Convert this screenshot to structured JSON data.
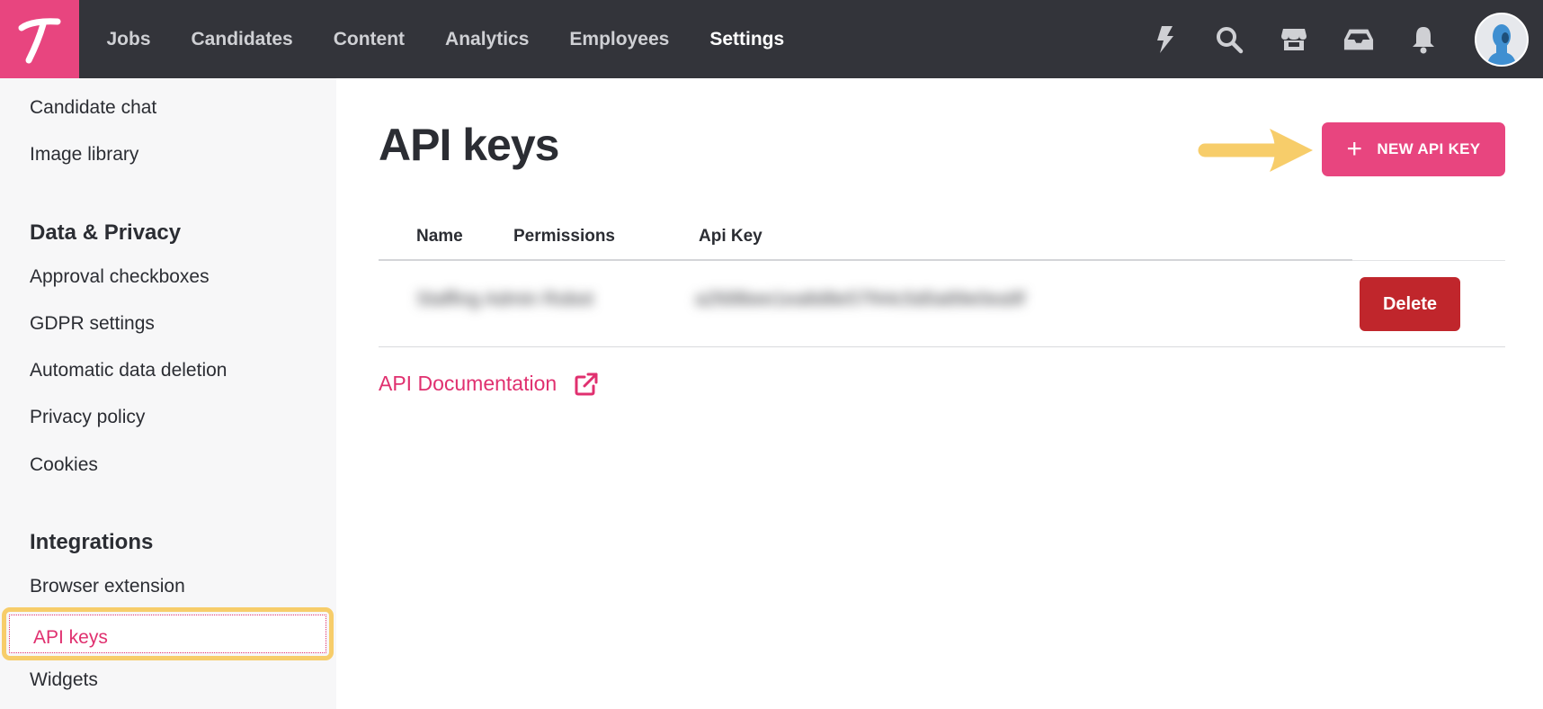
{
  "app": {
    "logo_letter": "T",
    "brand_color": "#e8457f"
  },
  "nav": {
    "items": [
      {
        "label": "Jobs"
      },
      {
        "label": "Candidates"
      },
      {
        "label": "Content"
      },
      {
        "label": "Analytics"
      },
      {
        "label": "Employees"
      },
      {
        "label": "Settings",
        "active": true
      }
    ],
    "icons": [
      "bolt-icon",
      "search-icon",
      "store-icon",
      "inbox-icon",
      "bell-icon"
    ]
  },
  "sidebar": {
    "items_top": [
      {
        "label": "Candidate chat"
      },
      {
        "label": "Image library"
      }
    ],
    "data_privacy": {
      "heading": "Data & Privacy",
      "items": [
        {
          "label": "Approval checkboxes"
        },
        {
          "label": "GDPR settings"
        },
        {
          "label": "Automatic data deletion"
        },
        {
          "label": "Privacy policy"
        },
        {
          "label": "Cookies"
        }
      ]
    },
    "integrations": {
      "heading": "Integrations",
      "items": [
        {
          "label": "Browser extension"
        },
        {
          "label": "API keys",
          "active": true
        },
        {
          "label": "Widgets"
        }
      ]
    }
  },
  "main": {
    "title": "API keys",
    "new_button_label": "NEW API KEY",
    "table": {
      "headers": [
        "Name",
        "Permissions",
        "Api Key"
      ],
      "rows": [
        {
          "name": "Staffing Admin Robot",
          "api_key": "a2fd9bee1ea8d8e57f44c5d0a89e0ea9f",
          "delete_label": "Delete"
        }
      ]
    },
    "doc_link_label": "API Documentation"
  },
  "colors": {
    "topbar": "#33343a",
    "accent": "#e8457f",
    "delete": "#c0262c",
    "highlight": "#f7cd6a"
  }
}
